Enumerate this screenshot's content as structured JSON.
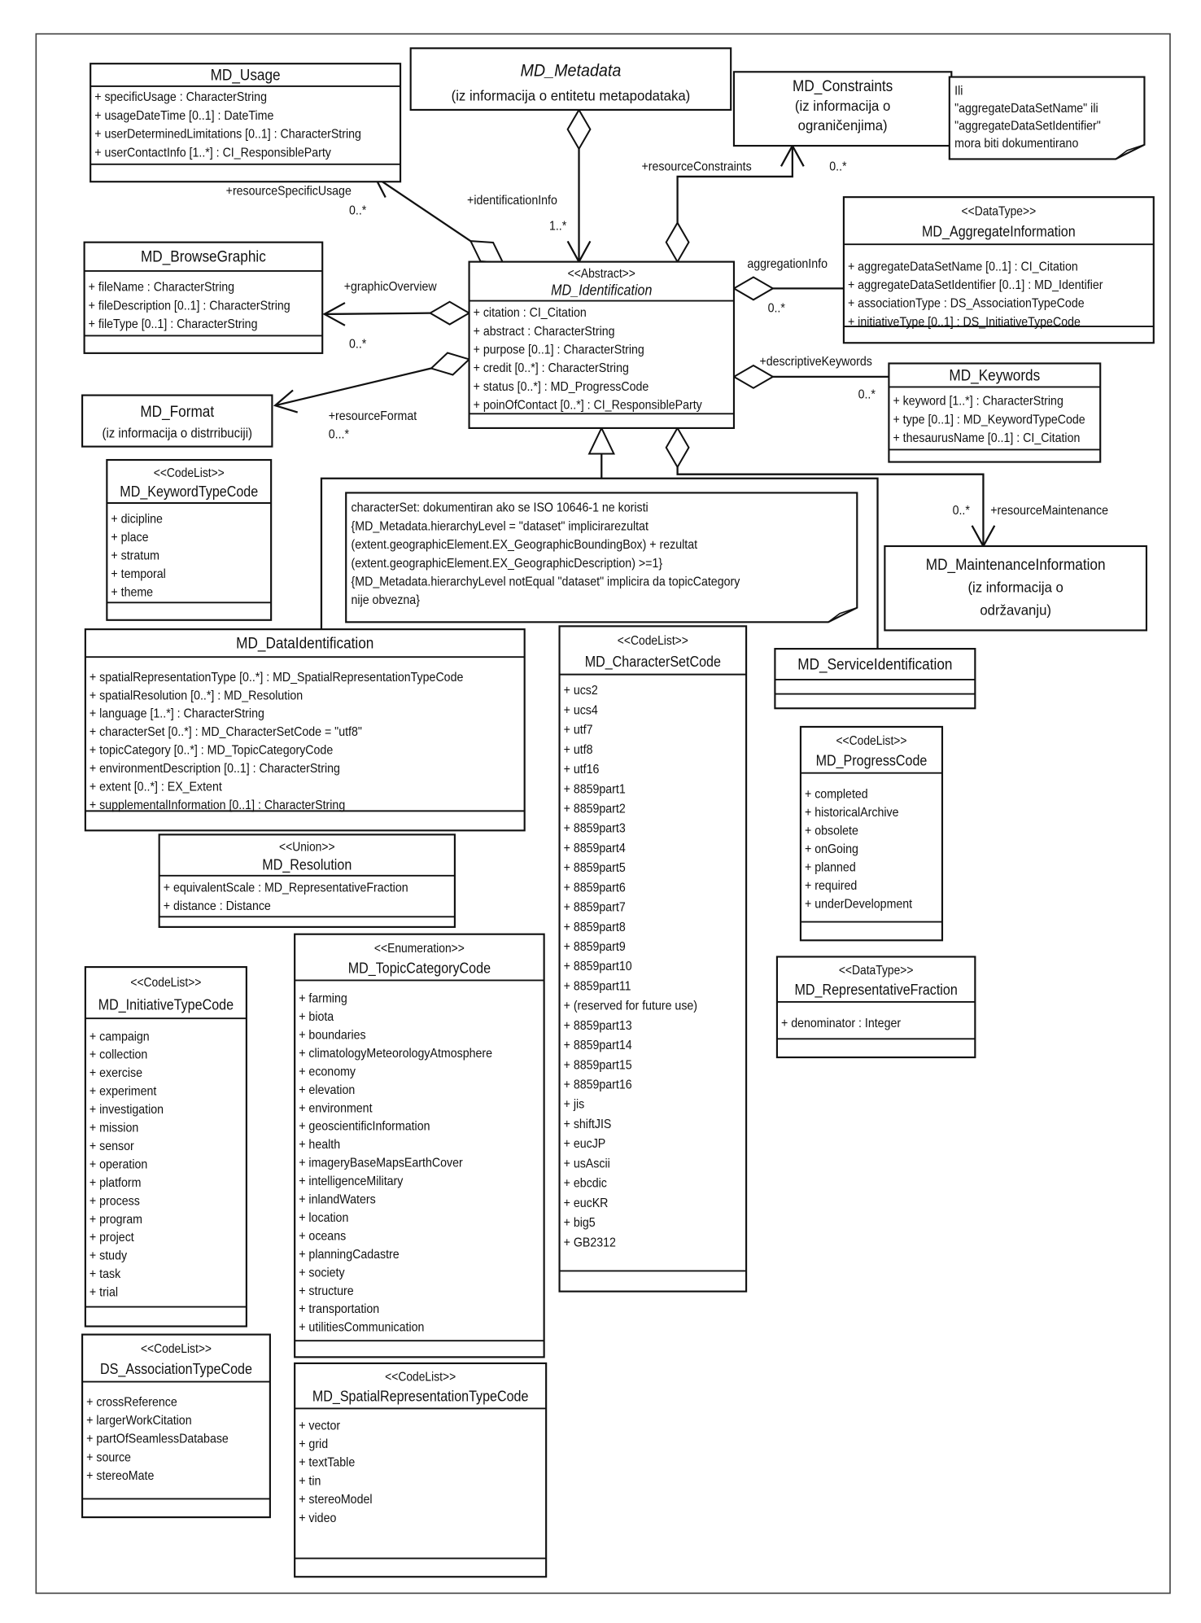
{
  "diagram": {
    "classes": {
      "usage": {
        "name": "MD_Usage",
        "attributes": [
          "+ specificUsage : CharacterString",
          "+ usageDateTime [0..1] : DateTime",
          "+ userDeterminedLimitations [0..1] : CharacterString",
          "+ userContactInfo [1..*] : CI_ResponsibleParty"
        ]
      },
      "metadata": {
        "name": "MD_Metadata",
        "italic": true,
        "subtitle": [
          "(iz informacija o entitetu metapodataka)"
        ]
      },
      "constraints": {
        "name": "MD_Constraints",
        "subtitle": [
          "(iz informacija o",
          "ograničenjima)"
        ]
      },
      "aggregate": {
        "stereotype": "<<DataType>>",
        "name": "MD_AggregateInformation",
        "attributes": [
          "+ aggregateDataSetName [0..1] : CI_Citation",
          "+ aggregateDataSetIdentifier [0..1] : MD_Identifier",
          "+ associationType : DS_AssociationTypeCode",
          "+ initiativeType [0..1] : DS_InitiativeTypeCode"
        ]
      },
      "browse": {
        "name": "MD_BrowseGraphic",
        "attributes": [
          "+ fileName : CharacterString",
          "+ fileDescription [0..1] : CharacterString",
          "+ fileType [0..1] : CharacterString"
        ]
      },
      "ident": {
        "stereotype": "<<Abstract>>",
        "name": "MD_Identification",
        "italic": true,
        "attributes": [
          "+ citation : CI_Citation",
          "+ abstract : CharacterString",
          "+ purpose [0..1] : CharacterString",
          "+ credit [0..*] : CharacterString",
          "+ status [0..*] : MD_ProgressCode",
          "+ poinOfContact [0..*] : CI_ResponsibleParty"
        ]
      },
      "format": {
        "name": "MD_Format",
        "subtitle": [
          "(iz informacija o distrribuciji)"
        ]
      },
      "keywords": {
        "name": "MD_Keywords",
        "attributes": [
          "+ keyword [1..*] : CharacterString",
          "+ type [0..1] : MD_KeywordTypeCode",
          "+ thesaurusName [0..1] : CI_Citation"
        ]
      },
      "kwtype": {
        "stereotype": "<<CodeList>>",
        "name": "MD_KeywordTypeCode",
        "attributes": [
          "+ dicipline",
          "+ place",
          "+ stratum",
          "+ temporal",
          "+ theme"
        ]
      },
      "maint": {
        "name": "MD_MaintenanceInformation",
        "subtitle": [
          "(iz informacija o",
          "održavanju)"
        ]
      },
      "dataid": {
        "name": "MD_DataIdentification",
        "attributes": [
          "+ spatialRepresentationType [0..*] : MD_SpatialRepresentationTypeCode",
          "+ spatialResolution [0..*] : MD_Resolution",
          "+ language [1..*] : CharacterString",
          "+ characterSet [0..*] : MD_CharacterSetCode = \"utf8\"",
          "+ topicCategory [0..*] : MD_TopicCategoryCode",
          "+ environmentDescription [0..1] : CharacterString",
          "+ extent [0..*] : EX_Extent",
          "+ supplementalInformation [0..1] : CharacterString"
        ]
      },
      "charset": {
        "stereotype": "<<CodeList>>",
        "name": "MD_CharacterSetCode",
        "attributes": [
          "+ ucs2",
          "+ ucs4",
          "+ utf7",
          "+ utf8",
          "+ utf16",
          "+ 8859part1",
          "+ 8859part2",
          "+ 8859part3",
          "+ 8859part4",
          "+ 8859part5",
          "+ 8859part6",
          "+ 8859part7",
          "+ 8859part8",
          "+ 8859part9",
          "+ 8859part10",
          "+ 8859part11",
          "+ (reserved for future use)",
          "+ 8859part13",
          "+ 8859part14",
          "+ 8859part15",
          "+ 8859part16",
          "+ jis",
          "+ shiftJIS",
          "+ eucJP",
          "+ usAscii",
          "+ ebcdic",
          "+ eucKR",
          "+ big5",
          "+ GB2312"
        ]
      },
      "service": {
        "name": "MD_ServiceIdentification",
        "attributes": []
      },
      "resolution": {
        "stereotype": "<<Union>>",
        "name": "MD_Resolution",
        "attributes": [
          "+ equivalentScale : MD_RepresentativeFraction",
          "+ distance : Distance"
        ]
      },
      "progress": {
        "stereotype": "<<CodeList>>",
        "name": "MD_ProgressCode",
        "attributes": [
          "+ completed",
          "+ historicalArchive",
          "+ obsolete",
          "+ onGoing",
          "+ planned",
          "+ required",
          "+ underDevelopment"
        ]
      },
      "topic": {
        "stereotype": "<<Enumeration>>",
        "name": "MD_TopicCategoryCode",
        "attributes": [
          "+ farming",
          "+ biota",
          "+ boundaries",
          "+ climatologyMeteorologyAtmosphere",
          "+ economy",
          "+ elevation",
          "+ environment",
          "+ geoscientificInformation",
          "+ health",
          "+ imageryBaseMapsEarthCover",
          "+ intelligenceMilitary",
          "+ inlandWaters",
          "+ location",
          "+ oceans",
          "+ planningCadastre",
          "+ society",
          "+ structure",
          "+ transportation",
          "+ utilitiesCommunication"
        ]
      },
      "repfrac": {
        "stereotype": "<<DataType>>",
        "name": "MD_RepresentativeFraction",
        "attributes": [
          "+ denominator : Integer"
        ]
      },
      "initiative": {
        "stereotype": "<<CodeList>>",
        "name": "MD_InitiativeTypeCode",
        "attributes": [
          "+ campaign",
          "+ collection",
          "+ exercise",
          "+ experiment",
          "+ investigation",
          "+ mission",
          "+ sensor",
          "+ operation",
          "+ platform",
          "+ process",
          "+ program",
          "+ project",
          "+ study",
          "+ task",
          "+ trial"
        ]
      },
      "assoc": {
        "stereotype": "<<CodeList>>",
        "name": "DS_AssociationTypeCode",
        "attributes": [
          "+ crossReference",
          "+ largerWorkCitation",
          "+ partOfSeamlessDatabase",
          "+ source",
          "+ stereoMate"
        ]
      },
      "spatial": {
        "stereotype": "<<CodeList>>",
        "name": "MD_SpatialRepresentationTypeCode",
        "attributes": [
          "+ vector",
          "+ grid",
          "+ textTable",
          "+ tin",
          "+ stereoModel",
          "+ video"
        ]
      }
    },
    "notes": {
      "aggregate_note": {
        "lines": [
          "Ili",
          "\"aggregateDataSetName\" ili",
          "\"aggregateDataSetIdentifier\"",
          "mora biti dokumentirano"
        ]
      },
      "dataid_note": {
        "lines": [
          "characterSet: dokumentiran ako se ISO 10646-1 ne koristi",
          "{MD_Metadata.hierarchyLevel = \"dataset\" implicirarezultat",
          "(extent.geographicElement.EX_GeographicBoundingBox) + rezultat",
          "(extent.geographicElement.EX_GeographicDescription) >=1}",
          "{MD_Metadata.hierarchyLevel  notEqual  \"dataset\"  implicira  da  topicCategory",
          "nije obvezna}"
        ]
      }
    },
    "roles": {
      "identificationInfo": {
        "role": "+identificationInfo",
        "multiplicity": "1..*"
      },
      "usage": {
        "role": "+resourceSpecificUsage",
        "multiplicity": "0..*"
      },
      "browse": {
        "role": "+graphicOverview",
        "multiplicity": "0..*"
      },
      "format": {
        "role": "+resourceFormat",
        "multiplicity": "0...*"
      },
      "constraints": {
        "role": "+resourceConstraints",
        "multiplicity": "0..*"
      },
      "aggregate": {
        "role": "aggregationInfo",
        "multiplicity": "0..*"
      },
      "keywords": {
        "role": "+descriptiveKeywords",
        "multiplicity": "0..*"
      },
      "maint": {
        "role": "+resourceMaintenance",
        "multiplicity": "0..*"
      }
    },
    "colors": {
      "line": "#111111",
      "background": "#ffffff"
    }
  }
}
